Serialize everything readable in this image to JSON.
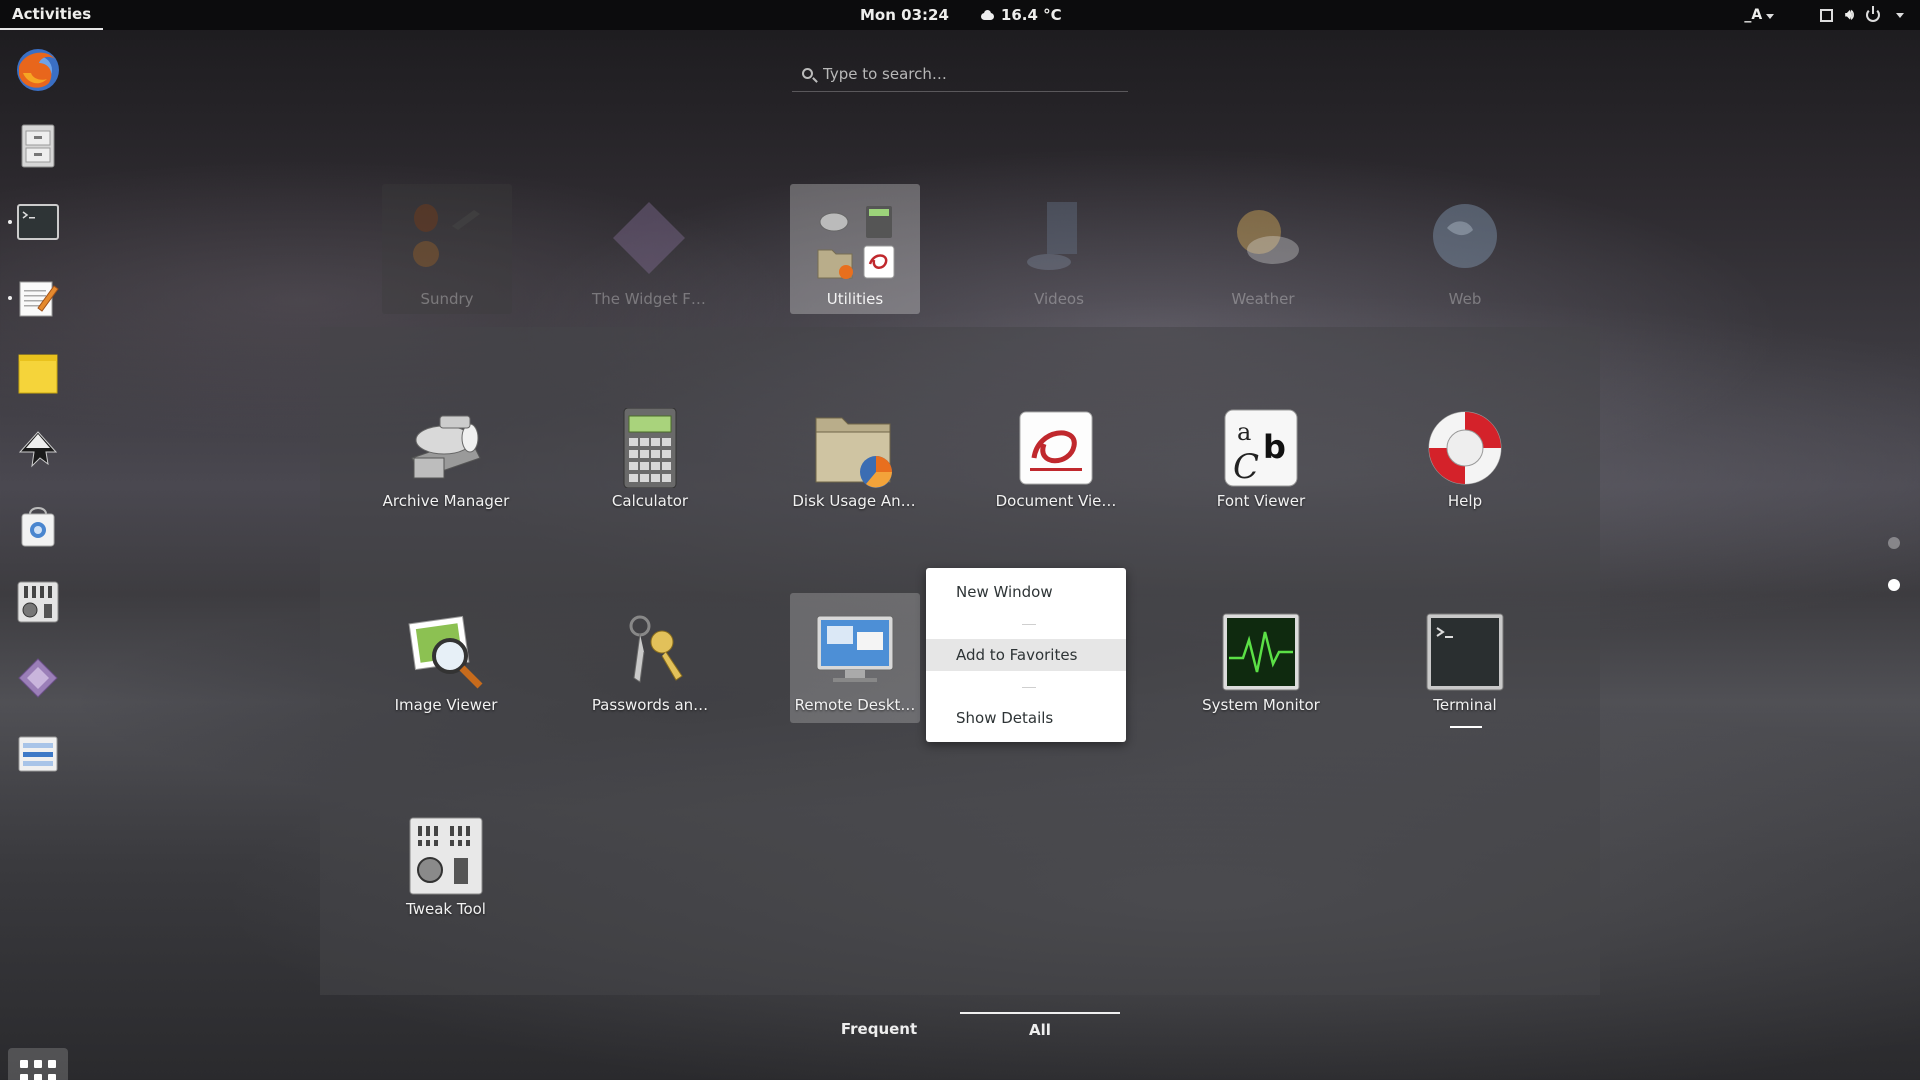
{
  "topbar": {
    "activities": "Activities",
    "clock": "Mon 03:24",
    "weather": "16.4 °C",
    "input_indicator": "_A"
  },
  "search": {
    "placeholder": "Type to search…"
  },
  "dash": {
    "items": [
      {
        "name": "firefox-icon"
      },
      {
        "name": "file-cabinet-icon"
      },
      {
        "name": "terminal-icon",
        "running": true
      },
      {
        "name": "text-editor-icon",
        "running": true
      },
      {
        "name": "sticky-notes-icon"
      },
      {
        "name": "inkscape-icon"
      },
      {
        "name": "software-store-icon"
      },
      {
        "name": "tweak-tool-icon"
      },
      {
        "name": "widget-factory-icon"
      },
      {
        "name": "settings-panel-icon"
      }
    ]
  },
  "folders": [
    {
      "label": "Sundry"
    },
    {
      "label": "The Widget F…"
    },
    {
      "label": "Utilities",
      "active": true
    },
    {
      "label": "Videos"
    },
    {
      "label": "Weather"
    },
    {
      "label": "Web"
    }
  ],
  "apps": [
    {
      "label": "Archive Manager",
      "icon": "archive-manager-icon"
    },
    {
      "label": "Calculator",
      "icon": "calculator-icon"
    },
    {
      "label": "Disk Usage An…",
      "icon": "disk-usage-icon"
    },
    {
      "label": "Document Vie…",
      "icon": "document-viewer-icon"
    },
    {
      "label": "Font Viewer",
      "icon": "font-viewer-icon"
    },
    {
      "label": "Help",
      "icon": "help-lifebuoy-icon"
    },
    {
      "label": "Image Viewer",
      "icon": "image-viewer-icon"
    },
    {
      "label": "Passwords an…",
      "icon": "passwords-keys-icon"
    },
    {
      "label": "Remote Deskt…",
      "icon": "remote-desktop-icon"
    },
    {
      "label": "System Monitor",
      "icon": "system-monitor-icon"
    },
    {
      "label": "Terminal",
      "icon": "terminal-icon"
    },
    {
      "label": "Tweak Tool",
      "icon": "tweak-tool-icon"
    }
  ],
  "context_menu": {
    "items": [
      "New Window",
      "Add to Favorites",
      "Show Details"
    ]
  },
  "tabs": {
    "frequent": "Frequent",
    "all": "All"
  },
  "colors": {
    "topbar": "#0c0c0d",
    "menu_bg": "#ffffff",
    "menu_highlight": "#e6e6e6"
  }
}
